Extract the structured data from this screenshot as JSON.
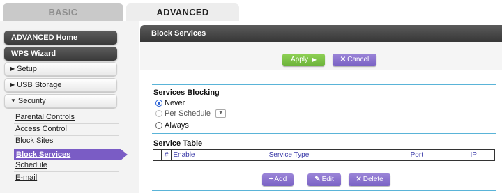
{
  "tabs": {
    "basic": "BASIC",
    "advanced": "ADVANCED"
  },
  "sidebar": {
    "advanced_home": "ADVANCED Home",
    "wps_wizard": "WPS Wizard",
    "setup": "Setup",
    "usb_storage": "USB Storage",
    "security": "Security",
    "security_items": [
      "Parental Controls",
      "Access Control",
      "Block Sites",
      "Block Services",
      "Schedule",
      "E-mail"
    ]
  },
  "panel": {
    "title": "Block Services",
    "apply_label": "Apply",
    "cancel_label": "Cancel",
    "services_blocking_title": "Services Blocking",
    "option_never": "Never",
    "option_per_schedule": "Per Schedule",
    "option_always": "Always",
    "selected_option": "Never",
    "service_table_title": "Service Table",
    "table_headers": [
      "#",
      "Enable",
      "Service Type",
      "Port",
      "IP"
    ],
    "add_label": "Add",
    "edit_label": "Edit",
    "delete_label": "Delete"
  },
  "colors": {
    "accent_purple": "#7a5cc5",
    "apply_green": "#7cc247",
    "divider_blue": "#5ab4d8"
  },
  "icons": {
    "apply": "play-arrow-icon",
    "cancel": "x-icon",
    "add": "plus-icon",
    "edit": "pencil-icon",
    "delete": "x-icon"
  }
}
